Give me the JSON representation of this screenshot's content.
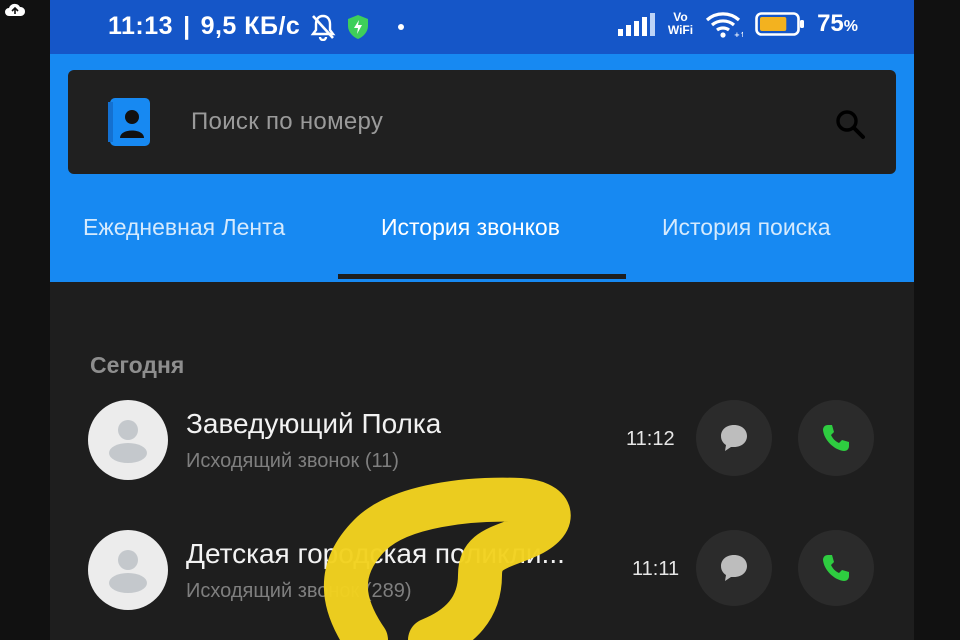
{
  "status_bar": {
    "time": "11:13",
    "separator": "|",
    "speed": "9,5 КБ/с",
    "vowifi_top": "Vo",
    "vowifi_bottom": "WiFi",
    "battery": "75",
    "battery_unit": "%",
    "battery_level": 0.75
  },
  "search": {
    "placeholder": "Поиск по номеру"
  },
  "tabs": [
    {
      "label": "Ежедневная Лента"
    },
    {
      "label": "История звонков",
      "active": true
    },
    {
      "label": "История поиска"
    }
  ],
  "section_title": "Сегодня",
  "calls": [
    {
      "name": "Заведующий Полка",
      "detail": "Исходящий звонок (11)",
      "time": "11:12"
    },
    {
      "name": "Детская городская поликли...",
      "detail": "Исходящий звонок (289)",
      "time": "11:11"
    }
  ],
  "colors": {
    "accent": "#1789f2",
    "status_bar": "#1556c8",
    "background": "#1e1e1e",
    "call_green": "#2ecc40",
    "highlight_marker": "#f2d21f"
  },
  "icons": {
    "top_left": "cloud-icon",
    "mute": "bell-off-icon",
    "shield": "shield-icon",
    "signal": "signal-icon",
    "wifi": "wifi-icon",
    "battery": "battery-icon",
    "contacts": "contact-book-icon",
    "search": "search-icon",
    "message": "message-icon",
    "call": "phone-icon"
  }
}
